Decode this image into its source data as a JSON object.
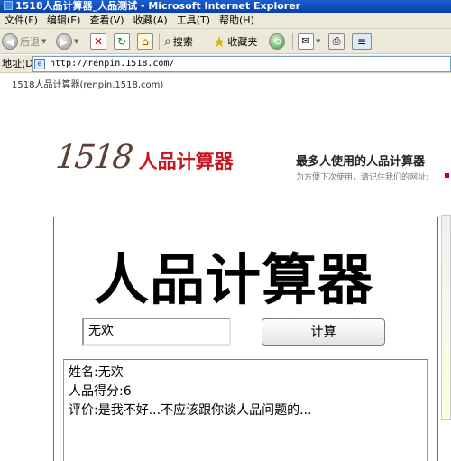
{
  "window": {
    "title": "1518人品计算器_人品测试 - Microsoft Internet Explorer"
  },
  "menu": {
    "items": [
      "文件(F)",
      "编辑(E)",
      "查看(V)",
      "收藏(A)",
      "工具(T)",
      "帮助(H)"
    ]
  },
  "toolbar": {
    "back_label": "后退",
    "search_label": "搜索",
    "favorites_label": "收藏夹"
  },
  "address": {
    "label": "地址(D)",
    "url": "http://renpin.1518.com/"
  },
  "tab": {
    "title": "1518人品计算器(renpin.1518.com)"
  },
  "header": {
    "logo_number": "1518",
    "logo_text": "人品计算器",
    "slogan": "最多人使用的人品计算器",
    "slogan_sub": "为方便下次使用，请记住我们的网址:"
  },
  "calculator": {
    "title": "人品计算器",
    "name_value": "无欢",
    "button_label": "计算"
  },
  "result": {
    "name_line": "姓名:无欢",
    "score_line": "人品得分:6",
    "comment_line": "评价:是我不好...不应该跟你谈人品问题的..."
  },
  "colors": {
    "brand_red": "#c8161e",
    "panel_border": "#d43b3b",
    "logo_brown": "#5a4036"
  }
}
